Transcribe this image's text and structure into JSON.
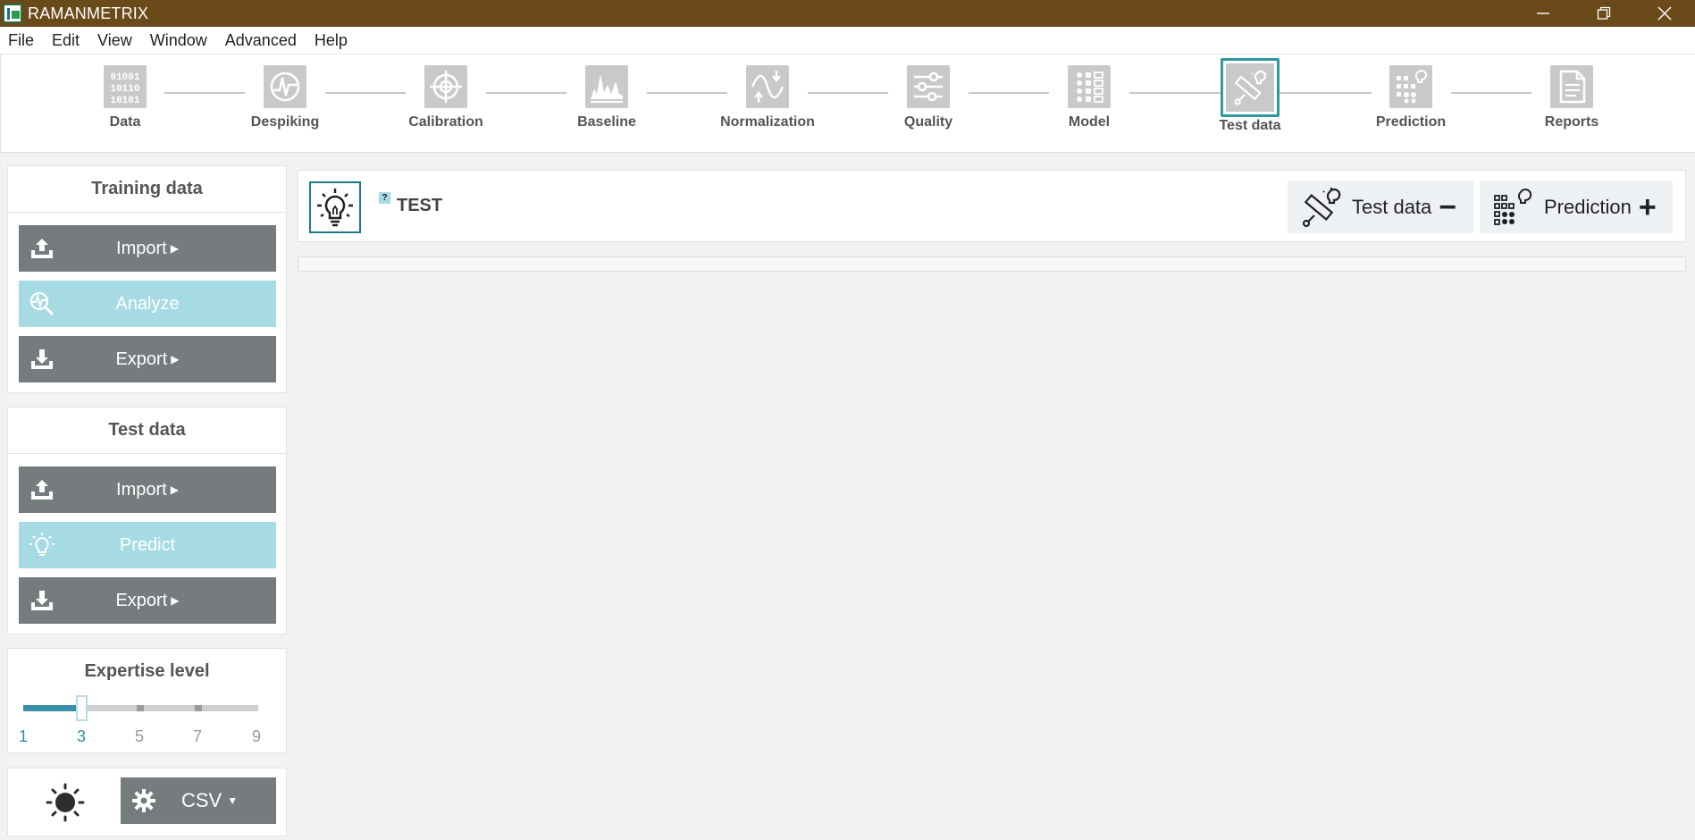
{
  "window": {
    "title": "RAMANMETRIX",
    "controls": [
      "minimize-icon",
      "restore-icon",
      "close-icon"
    ]
  },
  "menu": [
    "File",
    "Edit",
    "View",
    "Window",
    "Advanced",
    "Help"
  ],
  "workflow": {
    "steps": [
      {
        "label": "Data",
        "icon": "binary-data-icon"
      },
      {
        "label": "Despiking",
        "icon": "despiking-icon"
      },
      {
        "label": "Calibration",
        "icon": "crosshair-icon"
      },
      {
        "label": "Baseline",
        "icon": "spectrum-icon"
      },
      {
        "label": "Normalization",
        "icon": "normalization-wave-icon"
      },
      {
        "label": "Quality",
        "icon": "sliders-icon"
      },
      {
        "label": "Model",
        "icon": "grid-model-icon"
      },
      {
        "label": "Test data",
        "icon": "test-tube-bulb-icon",
        "active": true
      },
      {
        "label": "Prediction",
        "icon": "prediction-grid-bulb-icon"
      },
      {
        "label": "Reports",
        "icon": "document-icon"
      }
    ],
    "active_color": "#2f97a0"
  },
  "sidebar": {
    "training": {
      "title": "Training data",
      "import_label": "Import",
      "analyze_label": "Analyze",
      "export_label": "Export"
    },
    "test": {
      "title": "Test data",
      "import_label": "Import",
      "predict_label": "Predict",
      "export_label": "Export"
    },
    "expertise": {
      "title": "Expertise level",
      "levels": [
        "1",
        "3",
        "5",
        "7",
        "9"
      ],
      "selected": "3"
    },
    "toolbar": {
      "theme_icon": "sun-icon",
      "settings_icon": "gear-icon",
      "format_label": "CSV"
    }
  },
  "main": {
    "header_icon": "lightbulb-icon",
    "help_badge": "?",
    "title": "TEST",
    "test_data_button": "Test data",
    "test_data_sign": "−",
    "prediction_button": "Prediction",
    "prediction_sign": "+"
  },
  "colors": {
    "titlebar": "#6b4a19",
    "button_gray": "#767b7d",
    "button_teal": "#a6dbe3",
    "accent": "#2f97a0"
  }
}
